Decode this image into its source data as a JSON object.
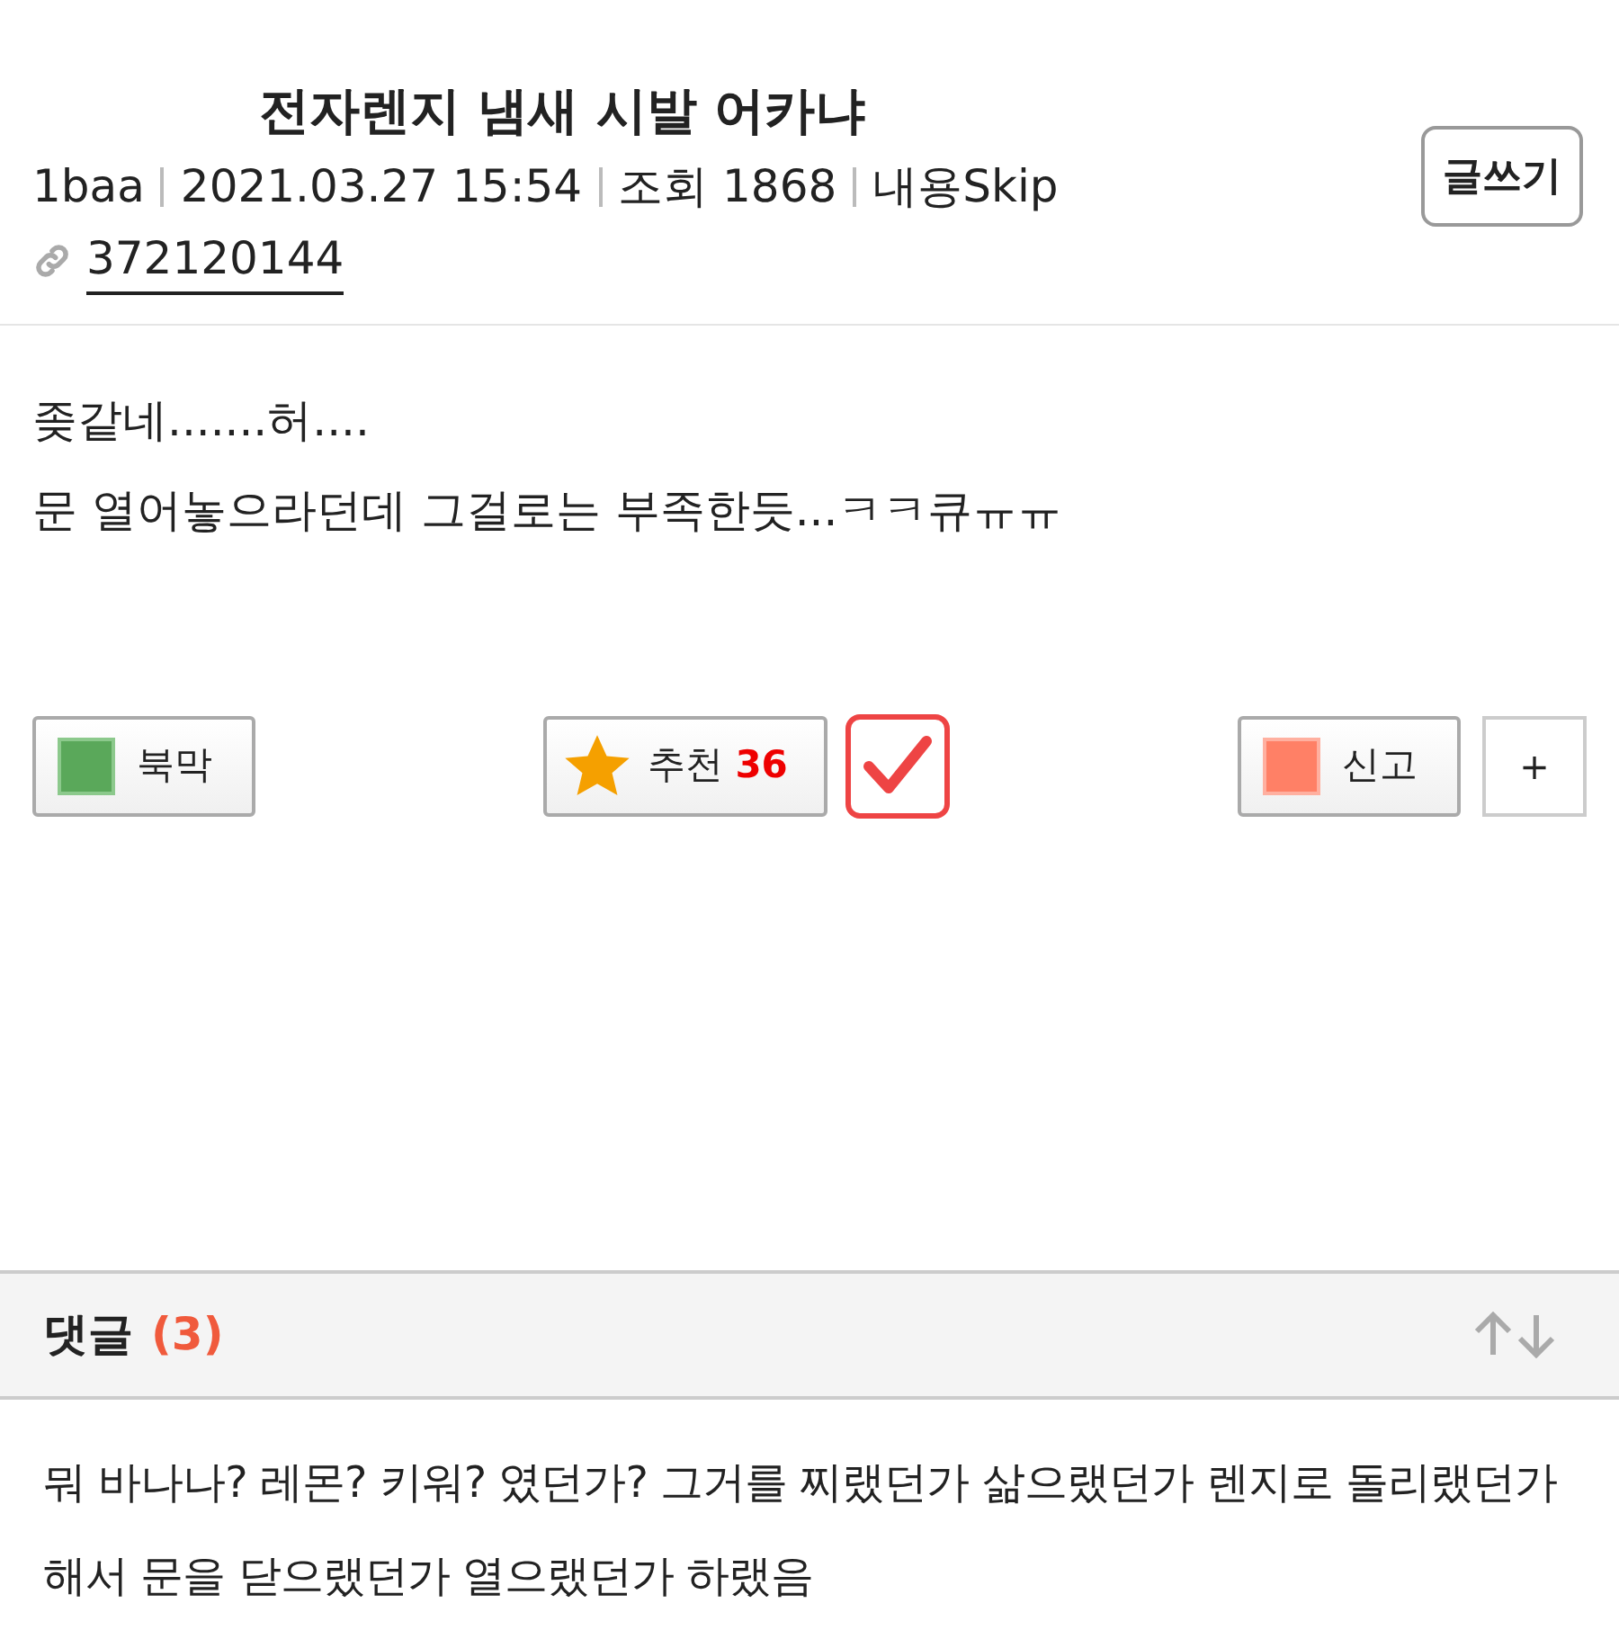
{
  "post": {
    "title": "전자렌지 냄새 시발 어카냐",
    "meta": [
      "1baa",
      "2021.03.27 15:54",
      "조회 1868",
      "내용Skip"
    ],
    "write_button": "글쓰기",
    "link": "372120144",
    "body": [
      "좆같네.......허....",
      "문 열어놓으라던데 그걸로는 부족한듯...ㅋㅋ큐ㅠㅠ"
    ]
  },
  "actions": {
    "bookmark": "북막",
    "recommend": {
      "label": "추천",
      "count": "36"
    },
    "voted": {
      "checked": true
    },
    "report": "신고",
    "more": "+"
  },
  "comments": {
    "title": "댓글",
    "count": "(3)",
    "items": [
      {
        "text": "뭐 바나나? 레몬? 키워? 였던가? 그거를 찌랬던가 삶으랬던가 렌지로 돌리랬던가 해서 문을 닫으랬던가 열으랬던가 하랬음"
      }
    ]
  }
}
